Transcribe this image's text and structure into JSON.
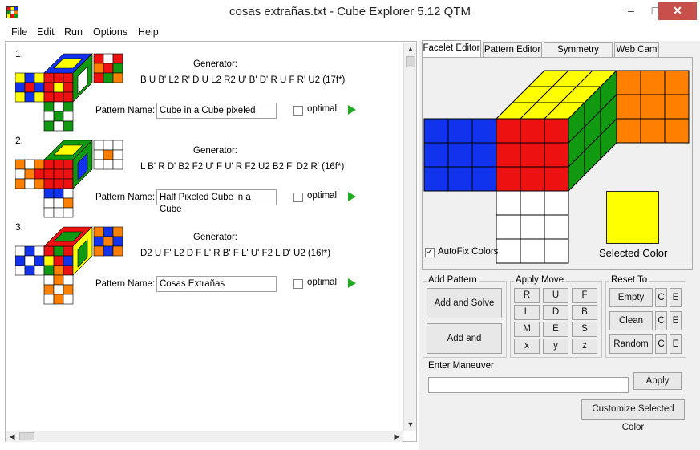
{
  "window": {
    "title": "cosas extrañas.txt - Cube Explorer 5.12 QTM",
    "minimize": "–",
    "maximize": "□",
    "close": "✕"
  },
  "menu": [
    "File",
    "Edit",
    "Run",
    "Options",
    "Help"
  ],
  "colors": {
    "white": "#ffffff",
    "red": "#ee1111",
    "green": "#119911",
    "blue": "#1133ee",
    "yellow": "#ffff00",
    "orange": "#ff7f00",
    "play": "#22aa22",
    "close_button": "#c7504a"
  },
  "patterns": [
    {
      "num": "1.",
      "generator_label": "Generator:",
      "generator": "B U B' L2 R' D U L2 R2 U' B' D' R U F R' U2  (17f*)",
      "pattern_name_label": "Pattern Name:",
      "pattern_name": "Cube in a Cube pixeled",
      "optimal_label": "optimal"
    },
    {
      "num": "2.",
      "generator_label": "Generator:",
      "generator": "L B' R D' B2 F2 U' F U' R F2 U2 B2 F' D2 R'  (16f*)",
      "pattern_name_label": "Pattern Name:",
      "pattern_name": "Half Pixeled Cube in a Cube",
      "optimal_label": "optimal"
    },
    {
      "num": "3.",
      "generator_label": "Generator:",
      "generator": "D2 U F' L2 D F L' R B' F L' U' F2 L D' U2  (16f*)",
      "pattern_name_label": "Pattern Name:",
      "pattern_name": "Cosas Extrañas",
      "optimal_label": "optimal"
    }
  ],
  "tabs": [
    "Facelet Editor",
    "Pattern Editor",
    "Symmetry Editor",
    "Web Cam"
  ],
  "facelet_editor": {
    "autofix_label": "AutoFix Colors",
    "autofix_checked": "✓",
    "selected_color_label": "Selected Color",
    "selected_color": "#ffff00"
  },
  "add_pattern": {
    "title": "Add Pattern",
    "add_and_solve": "Add and Solve",
    "add_and_generate": "Add and Generate"
  },
  "apply_move": {
    "title": "Apply Move",
    "moves": [
      "R",
      "U",
      "F",
      "L",
      "D",
      "B",
      "M",
      "E",
      "S",
      "x",
      "y",
      "z"
    ]
  },
  "reset_to": {
    "title": "Reset To",
    "buttons": [
      "Empty",
      "Clean",
      "Random"
    ],
    "c": "C",
    "e": "E"
  },
  "maneuver": {
    "title": "Enter Maneuver",
    "value": "",
    "apply": "Apply"
  },
  "customize_button": "Customize Selected Color"
}
